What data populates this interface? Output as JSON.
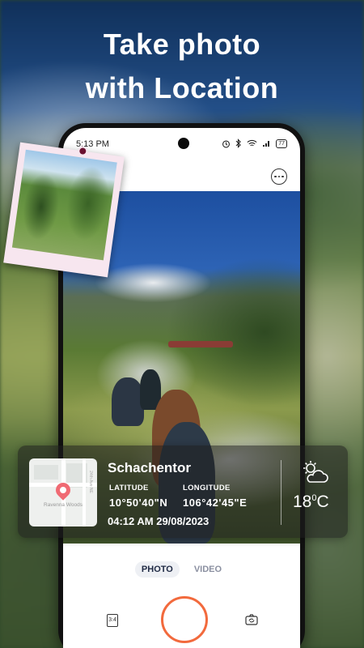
{
  "headline": {
    "line1": "Take photo",
    "line2": "with Location"
  },
  "status_bar": {
    "time": "5:13 PM",
    "battery": "77"
  },
  "camera": {
    "modes": [
      {
        "label": "PHOTO",
        "active": true
      },
      {
        "label": "VIDEO",
        "active": false
      }
    ],
    "aspect_label": "3:4",
    "shutter_color": "#f26a3d"
  },
  "location_card": {
    "place_name": "Schachentor",
    "latitude_label": "LATITUDE",
    "latitude_value": "10°50'40\"N",
    "longitude_label": "LONGITUDE",
    "longitude_value": "106°42'45\"E",
    "datetime": "04:12 AM 29/08/2023",
    "map_place_label": "Ravenna Woods",
    "map_street_label": "24th Ave NE",
    "temperature": "18",
    "temp_unit_sup": "0",
    "temp_unit": "C",
    "weather_icon": "partly-cloudy-icon"
  },
  "colors": {
    "accent": "#f26a3d",
    "pin": "#f06a73",
    "polaroid_frame": "#f7e6ef"
  }
}
